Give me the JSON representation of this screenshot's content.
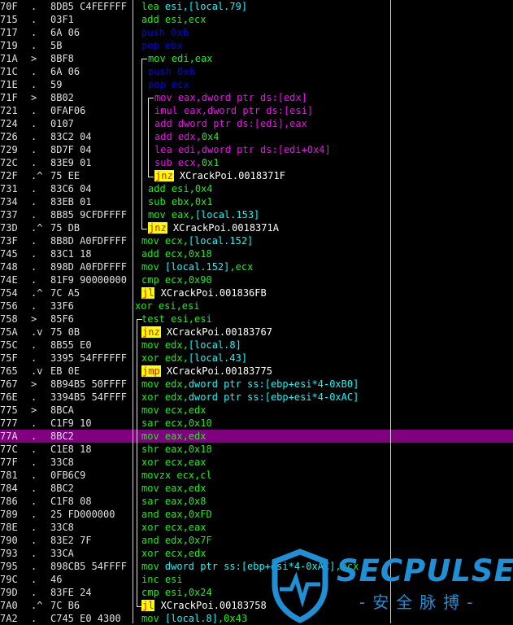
{
  "colors": {
    "mnem": "#00ff00",
    "reg": "#00ff00",
    "imm": "#00ff00",
    "push_pop": "#0000ff",
    "loop2": "#ff00ff",
    "jmp_text": "#ffffff",
    "ptr": "#00ffff",
    "local": "#00ffff",
    "label": "#ffffff",
    "highlight": "#800080"
  },
  "rows": [
    {
      "addr": "70F",
      "mark": ".",
      "hex": "8DB5 C4FEFFFF",
      "parts": [
        [
          "lea ",
          "g"
        ],
        [
          "esi,[local.79]",
          "c"
        ]
      ]
    },
    {
      "addr": "715",
      "mark": ".",
      "hex": "03F1",
      "parts": [
        [
          "add ",
          "g"
        ],
        [
          "esi,ecx",
          "g"
        ]
      ]
    },
    {
      "addr": "717",
      "mark": ".",
      "hex": "6A 06",
      "parts": [
        [
          "push ",
          "b"
        ],
        [
          "0x6",
          "b"
        ]
      ]
    },
    {
      "addr": "719",
      "mark": ".",
      "hex": "5B",
      "parts": [
        [
          "pop ",
          "b"
        ],
        [
          "ebx",
          "b"
        ]
      ]
    },
    {
      "addr": "71A",
      "mark": ">",
      "hex": "8BF8",
      "parts": [
        [
          "mov ",
          "g"
        ],
        [
          "edi,eax",
          "g"
        ]
      ]
    },
    {
      "addr": "71C",
      "mark": ".",
      "hex": "6A 06",
      "parts": [
        [
          "push ",
          "b"
        ],
        [
          "0x6",
          "b"
        ]
      ]
    },
    {
      "addr": "71E",
      "mark": ".",
      "hex": "59",
      "parts": [
        [
          "pop ",
          "b"
        ],
        [
          "ecx",
          "b"
        ]
      ]
    },
    {
      "addr": "71F",
      "mark": ">",
      "hex": "8B02",
      "parts": [
        [
          "mov ",
          "m"
        ],
        [
          "eax,",
          "m"
        ],
        [
          "dword ptr ds:[edx]",
          "m"
        ]
      ]
    },
    {
      "addr": "721",
      "mark": ".",
      "hex": "0FAF06",
      "parts": [
        [
          "imul ",
          "m"
        ],
        [
          "eax,",
          "m"
        ],
        [
          "dword ptr ds:[esi]",
          "m"
        ]
      ]
    },
    {
      "addr": "724",
      "mark": ".",
      "hex": "0107",
      "parts": [
        [
          "add ",
          "m"
        ],
        [
          "dword ptr ds:[edi]",
          "m"
        ],
        [
          ",eax",
          "m"
        ]
      ]
    },
    {
      "addr": "726",
      "mark": ".",
      "hex": "83C2 04",
      "parts": [
        [
          "add ",
          "m"
        ],
        [
          "edx,",
          "m"
        ],
        [
          "0x4",
          "g"
        ]
      ]
    },
    {
      "addr": "729",
      "mark": ".",
      "hex": "8D7F 04",
      "parts": [
        [
          "lea ",
          "m"
        ],
        [
          "edi,",
          "m"
        ],
        [
          "dword ptr ds:[edi+0x4]",
          "m"
        ]
      ]
    },
    {
      "addr": "72C",
      "mark": ".",
      "hex": "83E9 01",
      "parts": [
        [
          "sub ",
          "m"
        ],
        [
          "ecx,",
          "m"
        ],
        [
          "0x1",
          "g"
        ]
      ]
    },
    {
      "addr": "72F",
      "mark": ".^",
      "hex": "75 EE",
      "parts": [
        [
          "jnz",
          "j"
        ],
        [
          " XCrackPoi.0018371F",
          "w"
        ]
      ]
    },
    {
      "addr": "731",
      "mark": ".",
      "hex": "83C6 04",
      "parts": [
        [
          "add ",
          "g"
        ],
        [
          "esi,",
          "g"
        ],
        [
          "0x4",
          "g"
        ]
      ]
    },
    {
      "addr": "734",
      "mark": ".",
      "hex": "83EB 01",
      "parts": [
        [
          "sub ",
          "g"
        ],
        [
          "ebx,",
          "g"
        ],
        [
          "0x1",
          "g"
        ]
      ]
    },
    {
      "addr": "737",
      "mark": ".",
      "hex": "8B85 9CFDFFFF",
      "parts": [
        [
          "mov ",
          "g"
        ],
        [
          "eax,",
          "g"
        ],
        [
          "[local.153]",
          "c"
        ]
      ]
    },
    {
      "addr": "73D",
      "mark": ".^",
      "hex": "75 DB",
      "parts": [
        [
          "jnz",
          "j"
        ],
        [
          " XCrackPoi.0018371A",
          "w"
        ]
      ]
    },
    {
      "addr": "73F",
      "mark": ".",
      "hex": "8B8D A0FDFFFF",
      "parts": [
        [
          "mov ",
          "g"
        ],
        [
          "ecx,",
          "g"
        ],
        [
          "[local.152]",
          "c"
        ]
      ]
    },
    {
      "addr": "745",
      "mark": ".",
      "hex": "83C1 18",
      "parts": [
        [
          "add ",
          "g"
        ],
        [
          "ecx,",
          "g"
        ],
        [
          "0x18",
          "g"
        ]
      ]
    },
    {
      "addr": "748",
      "mark": ".",
      "hex": "898D A0FDFFFF",
      "parts": [
        [
          "mov ",
          "g"
        ],
        [
          "[local.152]",
          "c"
        ],
        [
          ",ecx",
          "g"
        ]
      ]
    },
    {
      "addr": "74E",
      "mark": ".",
      "hex": "81F9 90000000",
      "parts": [
        [
          "cmp ",
          "g"
        ],
        [
          "ecx,",
          "g"
        ],
        [
          "0x90",
          "g"
        ]
      ]
    },
    {
      "addr": "754",
      "mark": ".^",
      "hex": "7C A5",
      "parts": [
        [
          "jl",
          "j"
        ],
        [
          " XCrackPoi.001836FB",
          "w"
        ]
      ]
    },
    {
      "addr": "756",
      "mark": ".",
      "hex": "33F6",
      "parts": [
        [
          "xor ",
          "g"
        ],
        [
          "esi,esi",
          "g"
        ]
      ]
    },
    {
      "addr": "758",
      "mark": ">",
      "hex": "85F6",
      "parts": [
        [
          "test ",
          "g"
        ],
        [
          "esi,esi",
          "g"
        ]
      ]
    },
    {
      "addr": "75A",
      "mark": ".v",
      "hex": "75 0B",
      "parts": [
        [
          "jnz",
          "j"
        ],
        [
          " XCrackPoi.00183767",
          "w"
        ]
      ]
    },
    {
      "addr": "75C",
      "mark": ".",
      "hex": "8B55 E0",
      "parts": [
        [
          "mov ",
          "g"
        ],
        [
          "edx,",
          "g"
        ],
        [
          "[local.8]",
          "c"
        ]
      ]
    },
    {
      "addr": "75F",
      "mark": ".",
      "hex": "3395 54FFFFFF",
      "parts": [
        [
          "xor ",
          "g"
        ],
        [
          "edx,",
          "g"
        ],
        [
          "[local.43]",
          "c"
        ]
      ]
    },
    {
      "addr": "765",
      "mark": ".v",
      "hex": "EB 0E",
      "parts": [
        [
          "jmp",
          "j"
        ],
        [
          " XCrackPoi.00183775",
          "w"
        ]
      ]
    },
    {
      "addr": "767",
      "mark": ">",
      "hex": "8B94B5 50FFFF",
      "parts": [
        [
          "mov ",
          "g"
        ],
        [
          "edx,",
          "g"
        ],
        [
          "dword ptr ss:[ebp+esi*4-0xB0]",
          "c"
        ]
      ]
    },
    {
      "addr": "76E",
      "mark": ".",
      "hex": "3394B5 54FFFF",
      "parts": [
        [
          "xor ",
          "g"
        ],
        [
          "edx,",
          "g"
        ],
        [
          "dword ptr ss:[ebp+esi*4-0xAC]",
          "c"
        ]
      ]
    },
    {
      "addr": "775",
      "mark": ">",
      "hex": "8BCA",
      "parts": [
        [
          "mov ",
          "g"
        ],
        [
          "ecx,edx",
          "g"
        ]
      ]
    },
    {
      "addr": "777",
      "mark": ".",
      "hex": "C1F9 10",
      "parts": [
        [
          "sar ",
          "g"
        ],
        [
          "ecx,",
          "g"
        ],
        [
          "0x10",
          "g"
        ]
      ]
    },
    {
      "addr": "77A",
      "mark": ".",
      "hex": "8BC2",
      "parts": [
        [
          "mov ",
          "g"
        ],
        [
          "eax,edx",
          "g"
        ]
      ],
      "sel": true
    },
    {
      "addr": "77C",
      "mark": ".",
      "hex": "C1E8 18",
      "parts": [
        [
          "shr ",
          "g"
        ],
        [
          "eax,",
          "g"
        ],
        [
          "0x18",
          "g"
        ]
      ]
    },
    {
      "addr": "77F",
      "mark": ".",
      "hex": "33C8",
      "parts": [
        [
          "xor ",
          "g"
        ],
        [
          "ecx,eax",
          "g"
        ]
      ]
    },
    {
      "addr": "781",
      "mark": ".",
      "hex": "0FB6C9",
      "parts": [
        [
          "movzx ",
          "g"
        ],
        [
          "ecx,cl",
          "g"
        ]
      ]
    },
    {
      "addr": "784",
      "mark": ".",
      "hex": "8BC2",
      "parts": [
        [
          "mov ",
          "g"
        ],
        [
          "eax,edx",
          "g"
        ]
      ]
    },
    {
      "addr": "786",
      "mark": ".",
      "hex": "C1F8 08",
      "parts": [
        [
          "sar ",
          "g"
        ],
        [
          "eax,",
          "g"
        ],
        [
          "0x8",
          "g"
        ]
      ]
    },
    {
      "addr": "789",
      "mark": ".",
      "hex": "25 FD000000",
      "parts": [
        [
          "and ",
          "g"
        ],
        [
          "eax,",
          "g"
        ],
        [
          "0xFD",
          "g"
        ]
      ]
    },
    {
      "addr": "78E",
      "mark": ".",
      "hex": "33C8",
      "parts": [
        [
          "xor ",
          "g"
        ],
        [
          "ecx,eax",
          "g"
        ]
      ]
    },
    {
      "addr": "790",
      "mark": ".",
      "hex": "83E2 7F",
      "parts": [
        [
          "and ",
          "g"
        ],
        [
          "edx,",
          "g"
        ],
        [
          "0x7F",
          "g"
        ]
      ]
    },
    {
      "addr": "793",
      "mark": ".",
      "hex": "33CA",
      "parts": [
        [
          "xor ",
          "g"
        ],
        [
          "ecx,edx",
          "g"
        ]
      ]
    },
    {
      "addr": "795",
      "mark": ".",
      "hex": "898CB5 54FFFF",
      "parts": [
        [
          "mov ",
          "g"
        ],
        [
          "dword ptr ss:[ebp+esi*4-0xAC]",
          "c"
        ],
        [
          ",ecx",
          "g"
        ]
      ]
    },
    {
      "addr": "79C",
      "mark": ".",
      "hex": "46",
      "parts": [
        [
          "inc ",
          "g"
        ],
        [
          "esi",
          "g"
        ]
      ]
    },
    {
      "addr": "79D",
      "mark": ".",
      "hex": "83FE 24",
      "parts": [
        [
          "cmp ",
          "g"
        ],
        [
          "esi,",
          "g"
        ],
        [
          "0x24",
          "g"
        ]
      ]
    },
    {
      "addr": "7A0",
      "mark": ".^",
      "hex": "7C B6",
      "parts": [
        [
          "jl",
          "j"
        ],
        [
          " XCrackPoi.00183758",
          "w"
        ]
      ]
    },
    {
      "addr": "7A2",
      "mark": ".",
      "hex": "C745 E0 4300",
      "parts": [
        [
          "mov ",
          "g"
        ],
        [
          "[local.8]",
          "c"
        ],
        [
          ",0x43",
          "g"
        ]
      ]
    }
  ],
  "logo": {
    "name": "SECPULSE",
    "subtitle": "-安全脉搏-",
    "icon": "shield-icon"
  }
}
